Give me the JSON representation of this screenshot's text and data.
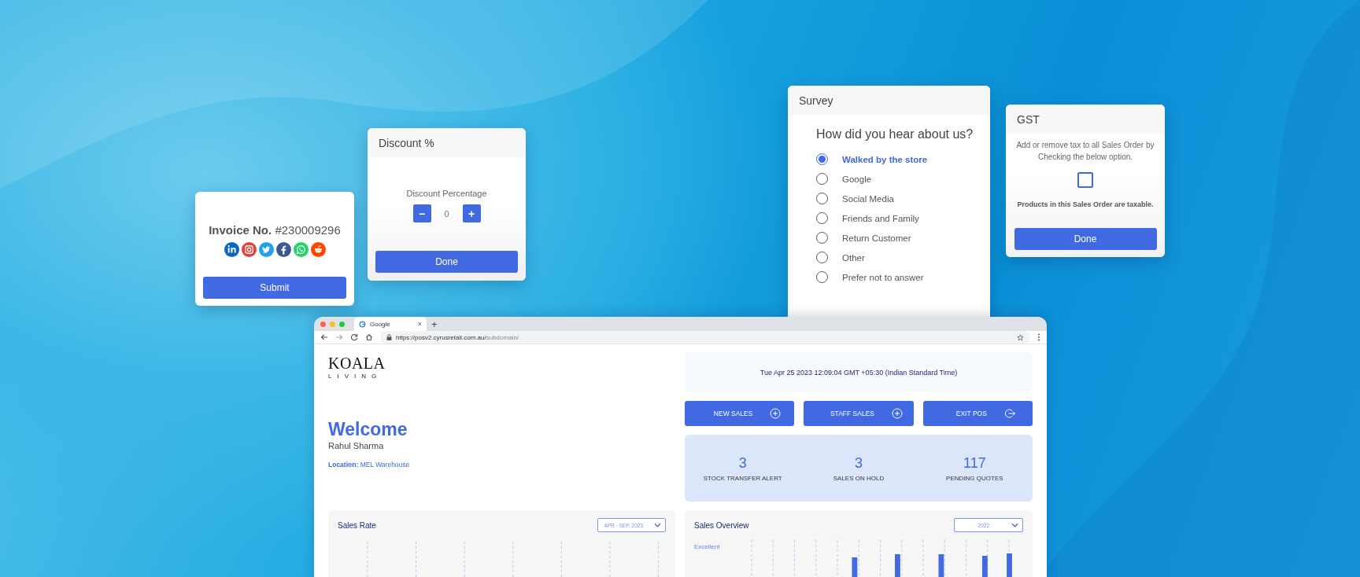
{
  "invoice_card": {
    "label": "Invoice No.",
    "number": "#230009296",
    "submit_button": "Submit"
  },
  "discount_card": {
    "title": "Discount %",
    "label": "Discount Percentage",
    "decrement": "−",
    "value": "0",
    "increment": "+",
    "done_button": "Done"
  },
  "survey_card": {
    "title": "Survey",
    "question": "How did you hear about us?",
    "options": [
      {
        "label": "Walked by the store",
        "selected": true
      },
      {
        "label": "Google",
        "selected": false
      },
      {
        "label": "Social Media",
        "selected": false
      },
      {
        "label": "Friends and Family",
        "selected": false
      },
      {
        "label": "Return Customer",
        "selected": false
      },
      {
        "label": "Other",
        "selected": false
      },
      {
        "label": "Prefer not to answer",
        "selected": false
      }
    ]
  },
  "gst_card": {
    "title": "GST",
    "description": "Add or remove tax to all Sales Order by Checking the below option.",
    "checked": false,
    "note": "Products in this Sales Order are taxable.",
    "done_button": "Done"
  },
  "browser": {
    "tab_title": "Google",
    "close_tab": "×",
    "new_tab": "+",
    "url_host": "https://posv2.cyrusretail.com.au/",
    "url_path": "subdomain/"
  },
  "dashboard": {
    "logo": {
      "name": "KOALA",
      "tagline": "LIVING"
    },
    "welcome": "Welcome",
    "user": "Rahul Sharma",
    "location_label": "Location:",
    "location": "MEL Warehouse",
    "datetime": "Tue Apr 25 2023 12:09:04 GMT +05:30 (Indian Standard Time)",
    "actions": [
      {
        "label": "NEW SALES",
        "kind": "add"
      },
      {
        "label": "STAFF SALES",
        "kind": "add"
      },
      {
        "label": "EXIT POS",
        "kind": "exit"
      }
    ],
    "stats": [
      {
        "value": "3",
        "label": "STOCK TRANSFER ALERT"
      },
      {
        "value": "3",
        "label": "SALES ON HOLD"
      },
      {
        "value": "117",
        "label": "PENDING QUOTES"
      }
    ],
    "sales_rate": {
      "title": "Sales Rate",
      "period": "APR - SEP, 2023"
    },
    "sales_overview": {
      "title": "Sales Overview",
      "year": "2022",
      "axis_label": "Excellent"
    }
  }
}
